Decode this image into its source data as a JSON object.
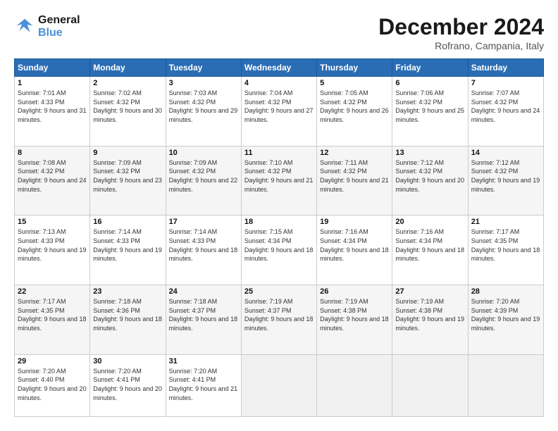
{
  "logo": {
    "line1": "General",
    "line2": "Blue"
  },
  "title": "December 2024",
  "subtitle": "Rofrano, Campania, Italy",
  "days_of_week": [
    "Sunday",
    "Monday",
    "Tuesday",
    "Wednesday",
    "Thursday",
    "Friday",
    "Saturday"
  ],
  "weeks": [
    [
      {
        "day": "1",
        "sunrise": "7:01 AM",
        "sunset": "4:33 PM",
        "daylight": "9 hours and 31 minutes."
      },
      {
        "day": "2",
        "sunrise": "7:02 AM",
        "sunset": "4:32 PM",
        "daylight": "9 hours and 30 minutes."
      },
      {
        "day": "3",
        "sunrise": "7:03 AM",
        "sunset": "4:32 PM",
        "daylight": "9 hours and 29 minutes."
      },
      {
        "day": "4",
        "sunrise": "7:04 AM",
        "sunset": "4:32 PM",
        "daylight": "9 hours and 27 minutes."
      },
      {
        "day": "5",
        "sunrise": "7:05 AM",
        "sunset": "4:32 PM",
        "daylight": "9 hours and 26 minutes."
      },
      {
        "day": "6",
        "sunrise": "7:06 AM",
        "sunset": "4:32 PM",
        "daylight": "9 hours and 25 minutes."
      },
      {
        "day": "7",
        "sunrise": "7:07 AM",
        "sunset": "4:32 PM",
        "daylight": "9 hours and 24 minutes."
      }
    ],
    [
      {
        "day": "8",
        "sunrise": "7:08 AM",
        "sunset": "4:32 PM",
        "daylight": "9 hours and 24 minutes."
      },
      {
        "day": "9",
        "sunrise": "7:09 AM",
        "sunset": "4:32 PM",
        "daylight": "9 hours and 23 minutes."
      },
      {
        "day": "10",
        "sunrise": "7:09 AM",
        "sunset": "4:32 PM",
        "daylight": "9 hours and 22 minutes."
      },
      {
        "day": "11",
        "sunrise": "7:10 AM",
        "sunset": "4:32 PM",
        "daylight": "9 hours and 21 minutes."
      },
      {
        "day": "12",
        "sunrise": "7:11 AM",
        "sunset": "4:32 PM",
        "daylight": "9 hours and 21 minutes."
      },
      {
        "day": "13",
        "sunrise": "7:12 AM",
        "sunset": "4:32 PM",
        "daylight": "9 hours and 20 minutes."
      },
      {
        "day": "14",
        "sunrise": "7:12 AM",
        "sunset": "4:32 PM",
        "daylight": "9 hours and 19 minutes."
      }
    ],
    [
      {
        "day": "15",
        "sunrise": "7:13 AM",
        "sunset": "4:33 PM",
        "daylight": "9 hours and 19 minutes."
      },
      {
        "day": "16",
        "sunrise": "7:14 AM",
        "sunset": "4:33 PM",
        "daylight": "9 hours and 19 minutes."
      },
      {
        "day": "17",
        "sunrise": "7:14 AM",
        "sunset": "4:33 PM",
        "daylight": "9 hours and 18 minutes."
      },
      {
        "day": "18",
        "sunrise": "7:15 AM",
        "sunset": "4:34 PM",
        "daylight": "9 hours and 18 minutes."
      },
      {
        "day": "19",
        "sunrise": "7:16 AM",
        "sunset": "4:34 PM",
        "daylight": "9 hours and 18 minutes."
      },
      {
        "day": "20",
        "sunrise": "7:16 AM",
        "sunset": "4:34 PM",
        "daylight": "9 hours and 18 minutes."
      },
      {
        "day": "21",
        "sunrise": "7:17 AM",
        "sunset": "4:35 PM",
        "daylight": "9 hours and 18 minutes."
      }
    ],
    [
      {
        "day": "22",
        "sunrise": "7:17 AM",
        "sunset": "4:35 PM",
        "daylight": "9 hours and 18 minutes."
      },
      {
        "day": "23",
        "sunrise": "7:18 AM",
        "sunset": "4:36 PM",
        "daylight": "9 hours and 18 minutes."
      },
      {
        "day": "24",
        "sunrise": "7:18 AM",
        "sunset": "4:37 PM",
        "daylight": "9 hours and 18 minutes."
      },
      {
        "day": "25",
        "sunrise": "7:19 AM",
        "sunset": "4:37 PM",
        "daylight": "9 hours and 18 minutes."
      },
      {
        "day": "26",
        "sunrise": "7:19 AM",
        "sunset": "4:38 PM",
        "daylight": "9 hours and 18 minutes."
      },
      {
        "day": "27",
        "sunrise": "7:19 AM",
        "sunset": "4:38 PM",
        "daylight": "9 hours and 19 minutes."
      },
      {
        "day": "28",
        "sunrise": "7:20 AM",
        "sunset": "4:39 PM",
        "daylight": "9 hours and 19 minutes."
      }
    ],
    [
      {
        "day": "29",
        "sunrise": "7:20 AM",
        "sunset": "4:40 PM",
        "daylight": "9 hours and 20 minutes."
      },
      {
        "day": "30",
        "sunrise": "7:20 AM",
        "sunset": "4:41 PM",
        "daylight": "9 hours and 20 minutes."
      },
      {
        "day": "31",
        "sunrise": "7:20 AM",
        "sunset": "4:41 PM",
        "daylight": "9 hours and 21 minutes."
      },
      null,
      null,
      null,
      null
    ]
  ]
}
